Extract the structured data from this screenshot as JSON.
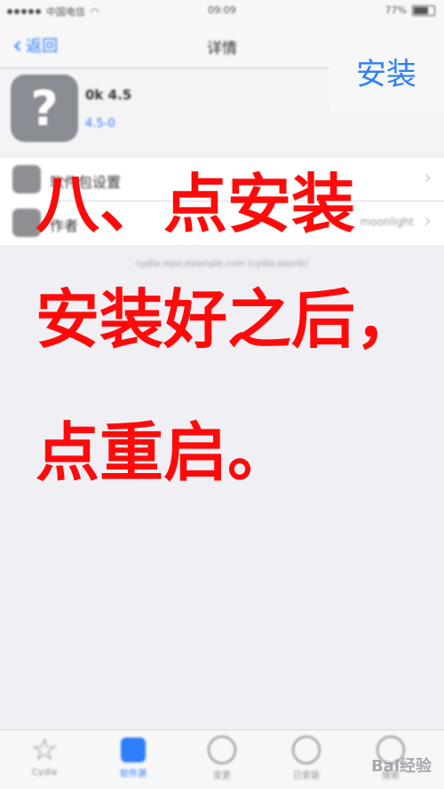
{
  "status_bar": {
    "carrier": "中国电信",
    "time": "09:09",
    "battery": "77%"
  },
  "nav": {
    "back_label": "返回",
    "title": "详情",
    "install_label": "安装"
  },
  "app": {
    "name": "0k 4.5",
    "version": "4.5-0"
  },
  "settings": [
    {
      "label": "软件包设置",
      "value": ""
    },
    {
      "label": "作者",
      "value": "moonlight"
    }
  ],
  "footnote": "cydia.repo.example.com (cydia.saurik)",
  "overlay": {
    "line1": "八、点安装",
    "line2": "安装好之后，",
    "line3": "点重启。"
  },
  "tabs": [
    {
      "label": "Cydia",
      "icon": "star-icon"
    },
    {
      "label": "软件源",
      "icon": "sources-icon",
      "active": true
    },
    {
      "label": "变更",
      "icon": "clock-icon"
    },
    {
      "label": "已安装",
      "icon": "download-icon"
    },
    {
      "label": "搜索",
      "icon": "search-icon"
    }
  ],
  "watermark": "Bai经验",
  "colors": {
    "accent": "#2d7ff9",
    "overlay_text": "#ff0a0a",
    "background": "#efeff4"
  }
}
